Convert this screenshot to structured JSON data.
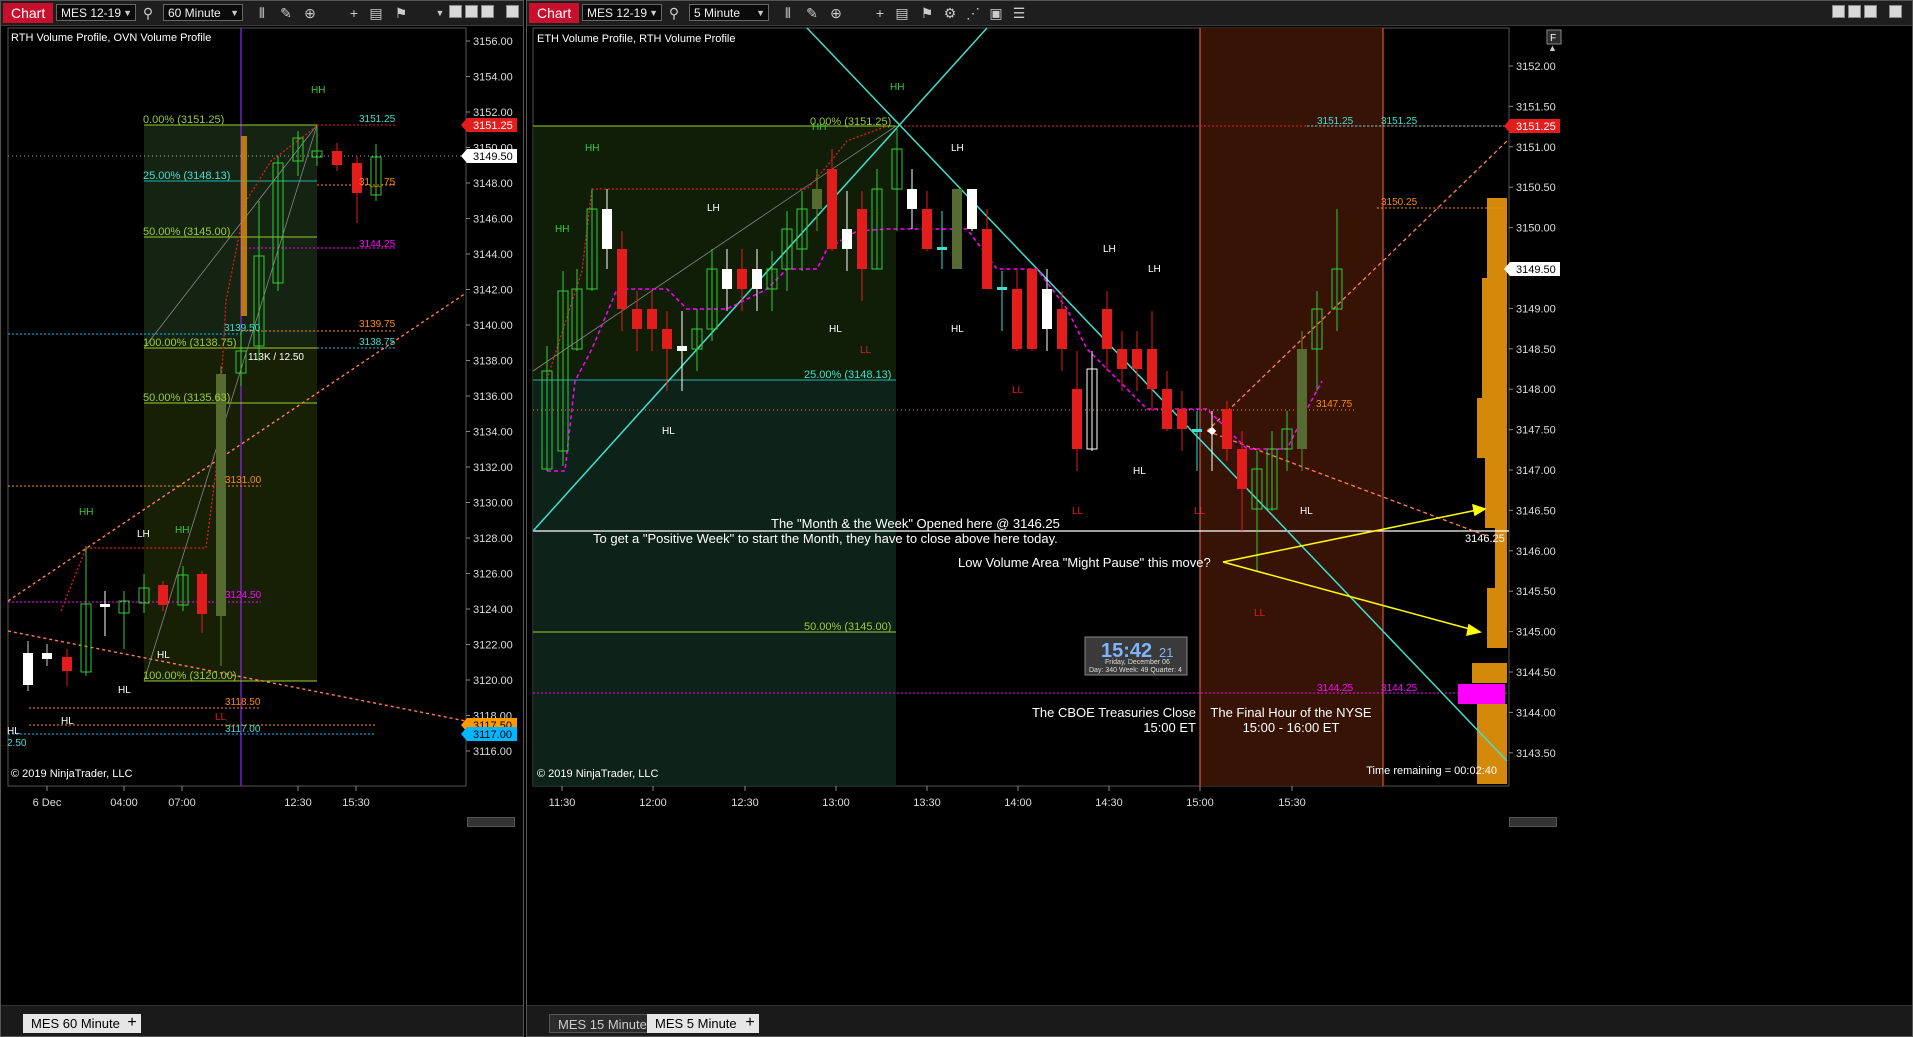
{
  "left": {
    "chart_button": "Chart",
    "instrument": "MES 12-19",
    "interval": "60 Minute",
    "indicator_label": "RTH Volume Profile, OVN Volume Profile",
    "copyright": "© 2019 NinjaTrader, LLC",
    "tabs": [
      {
        "label": "MES  60 Minute",
        "active": true
      }
    ],
    "add_tab": "+",
    "price_axis": [
      "3156.00",
      "3154.00",
      "3152.00",
      "3150.00",
      "3148.00",
      "3146.00",
      "3144.00",
      "3142.00",
      "3140.00",
      "3138.00",
      "3136.00",
      "3134.00",
      "3132.00",
      "3130.00",
      "3128.00",
      "3126.00",
      "3124.00",
      "3122.00",
      "3120.00",
      "3118.00",
      "3116.00"
    ],
    "time_axis": [
      "6 Dec",
      "04:00",
      "07:00",
      "12:30",
      "15:30"
    ],
    "price_tags": [
      {
        "text": "3151.25",
        "color": "#e31c1c"
      },
      {
        "text": "3149.50",
        "color": "#ffffff"
      },
      {
        "text": "3117.50",
        "color": "#ff9a00"
      },
      {
        "text": "3117.00",
        "color": "#00b7ff"
      }
    ],
    "fib_labels": [
      "0.00% (3151.25)",
      "25.00% (3148.13)",
      "50.00% (3145.00)",
      "100.00% (3138.75)",
      "50.00% (3135.63)",
      "100.00% (3120.00)"
    ],
    "level_labels": [
      "3151.25",
      "31__.75",
      "3144.25",
      "3139.50",
      "3139.75",
      "3138.75",
      "3131.00",
      "3124.50",
      "3118.50",
      "3117.00",
      "2.50",
      "HL"
    ],
    "volume_note": "113K / 12.50",
    "swing_labels": [
      "HH",
      "HH",
      "LH",
      "HH",
      "HL",
      "HL",
      "HL",
      "LL"
    ]
  },
  "right": {
    "chart_button": "Chart",
    "instrument": "MES 12-19",
    "interval": "5 Minute",
    "indicator_label": "ETH Volume Profile, RTH Volume Profile",
    "copyright": "© 2019 NinjaTrader, LLC",
    "tabs": [
      {
        "label": "MES  15 Minute",
        "active": false
      },
      {
        "label": "MES  5 Minute",
        "active": true
      }
    ],
    "add_tab": "+",
    "price_axis": [
      "3152.00",
      "3151.50",
      "3151.00",
      "3150.50",
      "3150.00",
      "3149.50",
      "3149.00",
      "3148.50",
      "3148.00",
      "3147.50",
      "3147.00",
      "3146.50",
      "3146.00",
      "3145.50",
      "3145.00",
      "3144.50",
      "3144.00",
      "3143.50"
    ],
    "time_axis": [
      "11:30",
      "12:00",
      "12:30",
      "13:00",
      "13:30",
      "14:00",
      "14:30",
      "15:00",
      "15:30"
    ],
    "price_tags": [
      {
        "text": "3151.25",
        "color": "#e31c1c"
      },
      {
        "text": "3149.50",
        "color": "#ffffff"
      }
    ],
    "fib_labels": [
      "0.00% (3151.25)",
      "25.00% (3148.13)",
      "50.00% (3145.00)"
    ],
    "level_labels": [
      "3151.25",
      "3151.25",
      "3150.25",
      "3147.75",
      "3146.25",
      "3144.25",
      "3144.25"
    ],
    "swing_labels": [
      "HH",
      "HH",
      "HH",
      "HH",
      "LH",
      "LH",
      "LH",
      "LH",
      "HL",
      "HL",
      "HL",
      "HL",
      "HL",
      "LL",
      "LL",
      "LL",
      "LL",
      "LL"
    ],
    "annotations": {
      "month_week": "The \"Month & the Week\" Opened here @ 3146.25",
      "positive_week": "To get a \"Positive Week\" to start the Month, they have to close above here today.",
      "low_volume": "Low Volume Area \"Might Pause\" this move?",
      "cboe_line1": "The CBOE Treasuries Close",
      "cboe_line2": "15:00 ET",
      "nyse_line1": "The Final Hour of the NYSE",
      "nyse_line2": "15:00 - 16:00 ET",
      "time_remaining": "Time remaining = 00:02:40"
    },
    "clock": {
      "time": "15:42",
      "seconds": "21",
      "date": "Friday, December 06",
      "stats": "Day: 340  Week: 49  Quarter: 4"
    },
    "f_button": "F"
  }
}
